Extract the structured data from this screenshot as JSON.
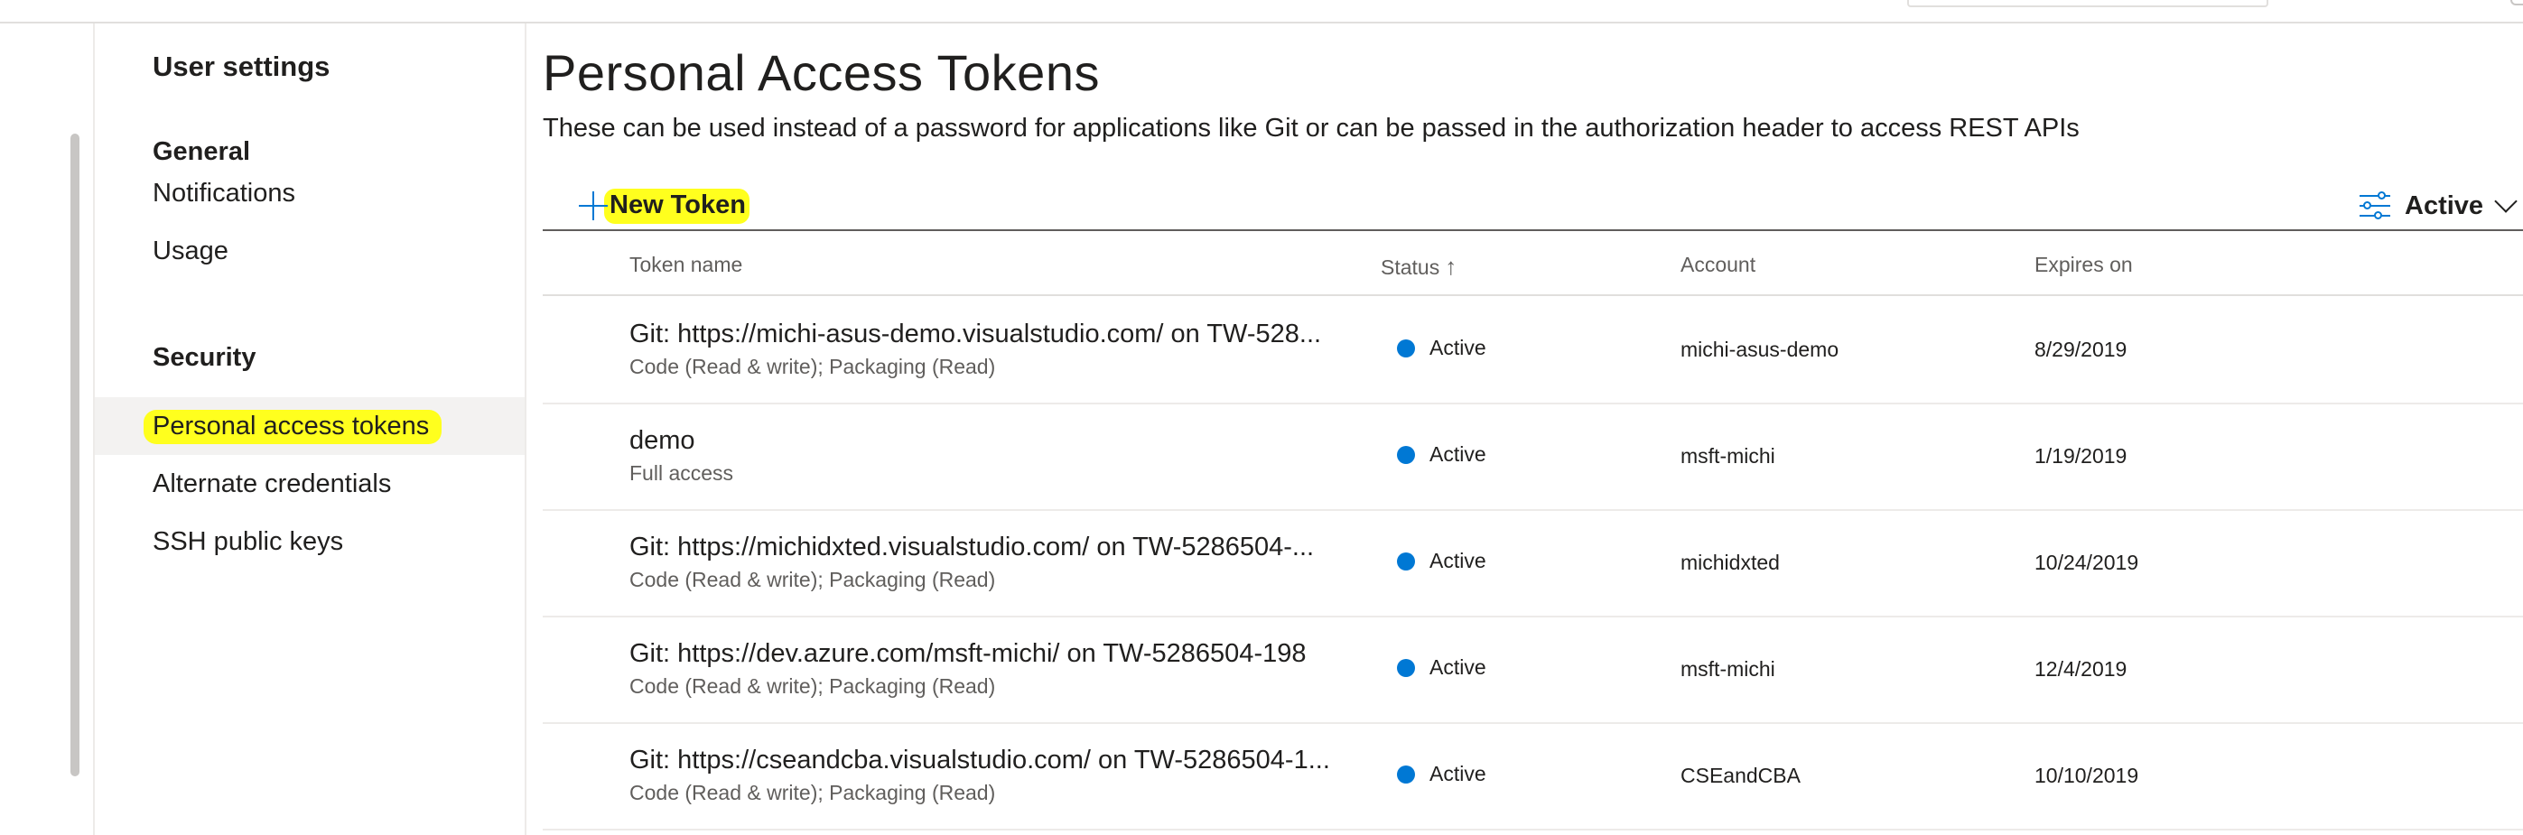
{
  "sidebar": {
    "title": "User settings",
    "sections": [
      {
        "heading": "General",
        "items": [
          "Notifications",
          "Usage"
        ]
      },
      {
        "heading": "Security",
        "items": [
          "Personal access tokens",
          "Alternate credentials",
          "SSH public keys"
        ]
      }
    ],
    "selected": "Personal access tokens"
  },
  "main": {
    "title": "Personal Access Tokens",
    "description": "These can be used instead of a password for applications like Git or can be passed in the authorization header to access REST APIs",
    "toolbar": {
      "new_token_label": "New Token",
      "filter_label": "Active"
    },
    "columns": {
      "name": "Token name",
      "status": "Status",
      "status_sort": "↑",
      "account": "Account",
      "expires": "Expires on"
    },
    "rows": [
      {
        "name": "Git: https://michi-asus-demo.visualstudio.com/ on TW-528...",
        "scope": "Code (Read & write); Packaging (Read)",
        "status": "Active",
        "account": "michi-asus-demo",
        "expires": "8/29/2019"
      },
      {
        "name": "demo",
        "scope": "Full access",
        "status": "Active",
        "account": "msft-michi",
        "expires": "1/19/2019"
      },
      {
        "name": "Git: https://michidxted.visualstudio.com/ on TW-5286504-...",
        "scope": "Code (Read & write); Packaging (Read)",
        "status": "Active",
        "account": "michidxted",
        "expires": "10/24/2019"
      },
      {
        "name": "Git: https://dev.azure.com/msft-michi/ on TW-5286504-198",
        "scope": "Code (Read & write); Packaging (Read)",
        "status": "Active",
        "account": "msft-michi",
        "expires": "12/4/2019"
      },
      {
        "name": "Git: https://cseandcba.visualstudio.com/ on TW-5286504-1...",
        "scope": "Code (Read & write); Packaging (Read)",
        "status": "Active",
        "account": "CSEandCBA",
        "expires": "10/10/2019"
      }
    ]
  },
  "colors": {
    "accent": "#0078d4",
    "highlight": "#ffff1e",
    "text": "#201f1e",
    "secondary_text": "#605e5c",
    "selected_bg": "#f3f2f1"
  },
  "icons": [
    "plus-icon",
    "filter-icon",
    "chevron-down-icon",
    "sort-ascending-icon",
    "status-dot-icon"
  ]
}
